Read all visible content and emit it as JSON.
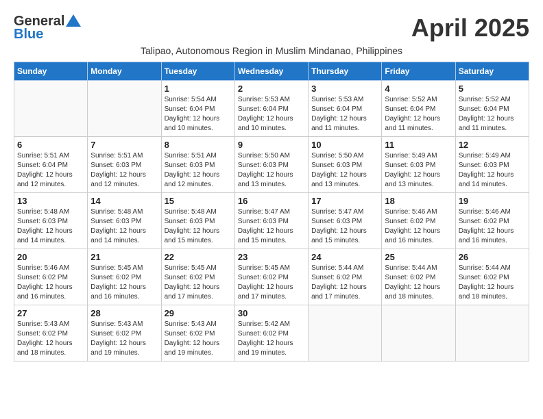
{
  "header": {
    "logo_general": "General",
    "logo_blue": "Blue",
    "month_title": "April 2025",
    "subtitle": "Talipao, Autonomous Region in Muslim Mindanao, Philippines"
  },
  "weekdays": [
    "Sunday",
    "Monday",
    "Tuesday",
    "Wednesday",
    "Thursday",
    "Friday",
    "Saturday"
  ],
  "weeks": [
    [
      {
        "day": "",
        "sunrise": "",
        "sunset": "",
        "daylight": ""
      },
      {
        "day": "",
        "sunrise": "",
        "sunset": "",
        "daylight": ""
      },
      {
        "day": "1",
        "sunrise": "Sunrise: 5:54 AM",
        "sunset": "Sunset: 6:04 PM",
        "daylight": "Daylight: 12 hours and 10 minutes."
      },
      {
        "day": "2",
        "sunrise": "Sunrise: 5:53 AM",
        "sunset": "Sunset: 6:04 PM",
        "daylight": "Daylight: 12 hours and 10 minutes."
      },
      {
        "day": "3",
        "sunrise": "Sunrise: 5:53 AM",
        "sunset": "Sunset: 6:04 PM",
        "daylight": "Daylight: 12 hours and 11 minutes."
      },
      {
        "day": "4",
        "sunrise": "Sunrise: 5:52 AM",
        "sunset": "Sunset: 6:04 PM",
        "daylight": "Daylight: 12 hours and 11 minutes."
      },
      {
        "day": "5",
        "sunrise": "Sunrise: 5:52 AM",
        "sunset": "Sunset: 6:04 PM",
        "daylight": "Daylight: 12 hours and 11 minutes."
      }
    ],
    [
      {
        "day": "6",
        "sunrise": "Sunrise: 5:51 AM",
        "sunset": "Sunset: 6:04 PM",
        "daylight": "Daylight: 12 hours and 12 minutes."
      },
      {
        "day": "7",
        "sunrise": "Sunrise: 5:51 AM",
        "sunset": "Sunset: 6:03 PM",
        "daylight": "Daylight: 12 hours and 12 minutes."
      },
      {
        "day": "8",
        "sunrise": "Sunrise: 5:51 AM",
        "sunset": "Sunset: 6:03 PM",
        "daylight": "Daylight: 12 hours and 12 minutes."
      },
      {
        "day": "9",
        "sunrise": "Sunrise: 5:50 AM",
        "sunset": "Sunset: 6:03 PM",
        "daylight": "Daylight: 12 hours and 13 minutes."
      },
      {
        "day": "10",
        "sunrise": "Sunrise: 5:50 AM",
        "sunset": "Sunset: 6:03 PM",
        "daylight": "Daylight: 12 hours and 13 minutes."
      },
      {
        "day": "11",
        "sunrise": "Sunrise: 5:49 AM",
        "sunset": "Sunset: 6:03 PM",
        "daylight": "Daylight: 12 hours and 13 minutes."
      },
      {
        "day": "12",
        "sunrise": "Sunrise: 5:49 AM",
        "sunset": "Sunset: 6:03 PM",
        "daylight": "Daylight: 12 hours and 14 minutes."
      }
    ],
    [
      {
        "day": "13",
        "sunrise": "Sunrise: 5:48 AM",
        "sunset": "Sunset: 6:03 PM",
        "daylight": "Daylight: 12 hours and 14 minutes."
      },
      {
        "day": "14",
        "sunrise": "Sunrise: 5:48 AM",
        "sunset": "Sunset: 6:03 PM",
        "daylight": "Daylight: 12 hours and 14 minutes."
      },
      {
        "day": "15",
        "sunrise": "Sunrise: 5:48 AM",
        "sunset": "Sunset: 6:03 PM",
        "daylight": "Daylight: 12 hours and 15 minutes."
      },
      {
        "day": "16",
        "sunrise": "Sunrise: 5:47 AM",
        "sunset": "Sunset: 6:03 PM",
        "daylight": "Daylight: 12 hours and 15 minutes."
      },
      {
        "day": "17",
        "sunrise": "Sunrise: 5:47 AM",
        "sunset": "Sunset: 6:03 PM",
        "daylight": "Daylight: 12 hours and 15 minutes."
      },
      {
        "day": "18",
        "sunrise": "Sunrise: 5:46 AM",
        "sunset": "Sunset: 6:02 PM",
        "daylight": "Daylight: 12 hours and 16 minutes."
      },
      {
        "day": "19",
        "sunrise": "Sunrise: 5:46 AM",
        "sunset": "Sunset: 6:02 PM",
        "daylight": "Daylight: 12 hours and 16 minutes."
      }
    ],
    [
      {
        "day": "20",
        "sunrise": "Sunrise: 5:46 AM",
        "sunset": "Sunset: 6:02 PM",
        "daylight": "Daylight: 12 hours and 16 minutes."
      },
      {
        "day": "21",
        "sunrise": "Sunrise: 5:45 AM",
        "sunset": "Sunset: 6:02 PM",
        "daylight": "Daylight: 12 hours and 16 minutes."
      },
      {
        "day": "22",
        "sunrise": "Sunrise: 5:45 AM",
        "sunset": "Sunset: 6:02 PM",
        "daylight": "Daylight: 12 hours and 17 minutes."
      },
      {
        "day": "23",
        "sunrise": "Sunrise: 5:45 AM",
        "sunset": "Sunset: 6:02 PM",
        "daylight": "Daylight: 12 hours and 17 minutes."
      },
      {
        "day": "24",
        "sunrise": "Sunrise: 5:44 AM",
        "sunset": "Sunset: 6:02 PM",
        "daylight": "Daylight: 12 hours and 17 minutes."
      },
      {
        "day": "25",
        "sunrise": "Sunrise: 5:44 AM",
        "sunset": "Sunset: 6:02 PM",
        "daylight": "Daylight: 12 hours and 18 minutes."
      },
      {
        "day": "26",
        "sunrise": "Sunrise: 5:44 AM",
        "sunset": "Sunset: 6:02 PM",
        "daylight": "Daylight: 12 hours and 18 minutes."
      }
    ],
    [
      {
        "day": "27",
        "sunrise": "Sunrise: 5:43 AM",
        "sunset": "Sunset: 6:02 PM",
        "daylight": "Daylight: 12 hours and 18 minutes."
      },
      {
        "day": "28",
        "sunrise": "Sunrise: 5:43 AM",
        "sunset": "Sunset: 6:02 PM",
        "daylight": "Daylight: 12 hours and 19 minutes."
      },
      {
        "day": "29",
        "sunrise": "Sunrise: 5:43 AM",
        "sunset": "Sunset: 6:02 PM",
        "daylight": "Daylight: 12 hours and 19 minutes."
      },
      {
        "day": "30",
        "sunrise": "Sunrise: 5:42 AM",
        "sunset": "Sunset: 6:02 PM",
        "daylight": "Daylight: 12 hours and 19 minutes."
      },
      {
        "day": "",
        "sunrise": "",
        "sunset": "",
        "daylight": ""
      },
      {
        "day": "",
        "sunrise": "",
        "sunset": "",
        "daylight": ""
      },
      {
        "day": "",
        "sunrise": "",
        "sunset": "",
        "daylight": ""
      }
    ]
  ]
}
